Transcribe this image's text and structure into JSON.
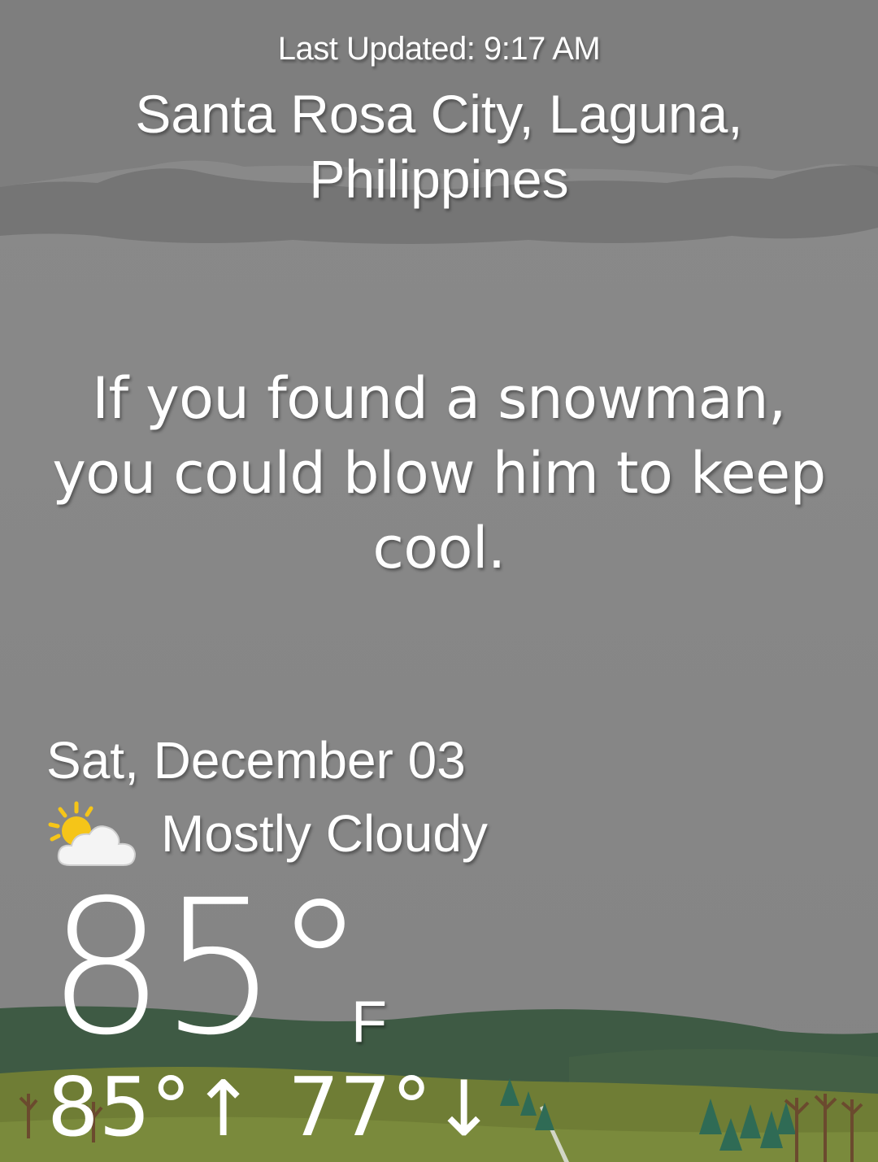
{
  "header": {
    "last_updated_label": "Last Updated:",
    "last_updated_time": "9:17 AM",
    "location": "Santa Rosa City, Laguna, Philippines"
  },
  "message": {
    "text": "If you found a snowman, you could blow him to keep cool."
  },
  "forecast": {
    "date": "Sat, December 03",
    "condition_icon": "partly-cloudy-icon",
    "condition": "Mostly Cloudy",
    "current_temp": "85°",
    "unit": "F",
    "high": "85°",
    "high_arrow": "↑",
    "low": "77°",
    "low_arrow": "↓"
  },
  "colors": {
    "sky": "#868686",
    "cloud_band": "#6e6e6e",
    "hill_dark": "#3e5a44",
    "hill_olive": "#6f7d35",
    "text": "#ffffff",
    "sun": "#f5c518"
  }
}
